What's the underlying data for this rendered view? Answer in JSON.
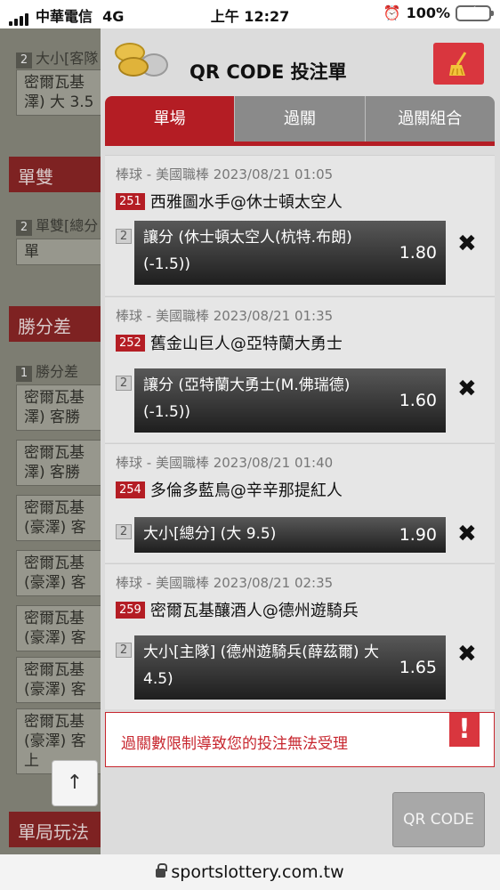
{
  "status_bar": {
    "carrier": "中華電信",
    "network": "4G",
    "time": "上午 12:27",
    "battery": "100%"
  },
  "background_page": {
    "section1": {
      "sub_num": "2",
      "sub_label": "大小[客隊",
      "box": [
        "密爾瓦基",
        "澤) 大 3.5"
      ]
    },
    "section2": {
      "title": "單雙",
      "sub_num": "2",
      "sub_label": "單雙[總分",
      "box": [
        "單"
      ]
    },
    "section3": {
      "title": "勝分差",
      "sub_num": "1",
      "sub_label": "勝分差",
      "boxes": [
        [
          "密爾瓦基",
          "澤) 客勝"
        ],
        [
          "密爾瓦基",
          "澤) 客勝"
        ],
        [
          "密爾瓦基",
          "(豪澤) 客"
        ],
        [
          "密爾瓦基",
          "(豪澤) 客"
        ],
        [
          "密爾瓦基",
          "(豪澤) 客"
        ],
        [
          "密爾瓦基",
          "(豪澤) 客"
        ],
        [
          "密爾瓦基",
          "(豪澤) 客",
          "上"
        ]
      ]
    },
    "section4": {
      "title": "單局玩法"
    },
    "up_button": "↑"
  },
  "panel": {
    "title": "QR CODE 投注單",
    "tabs": [
      {
        "label": "單場"
      },
      {
        "label": "過關"
      },
      {
        "label": "過關組合"
      }
    ],
    "bets": [
      {
        "meta": "棒球 - 美國職棒 2023/08/21 01:05",
        "match_no": "251",
        "match": "西雅圖水手@休士頓太空人",
        "sel_num": "2",
        "selection": "讓分 (休士頓太空人(杭特.布朗) (-1.5))",
        "odds": "1.80"
      },
      {
        "meta": "棒球 - 美國職棒 2023/08/21 01:35",
        "match_no": "252",
        "match": "舊金山巨人@亞特蘭大勇士",
        "sel_num": "2",
        "selection": "讓分 (亞特蘭大勇士(M.佛瑞德) (-1.5))",
        "odds": "1.60"
      },
      {
        "meta": "棒球 - 美國職棒 2023/08/21 01:40",
        "match_no": "254",
        "match": "多倫多藍鳥@辛辛那提紅人",
        "sel_num": "2",
        "selection": "大小[總分] (大 9.5)",
        "odds": "1.90"
      },
      {
        "meta": "棒球 - 美國職棒 2023/08/21 02:35",
        "match_no": "259",
        "match": "密爾瓦基釀酒人@德州遊騎兵",
        "sel_num": "2",
        "selection": "大小[主隊] (德州遊騎兵(薛茲爾) 大 4.5)",
        "odds": "1.65"
      }
    ],
    "remove_glyph": "✖",
    "error": {
      "text": "過關數限制導致您的投注無法受理",
      "icon": "!"
    },
    "qr_button": "QR CODE"
  },
  "url_bar": {
    "domain": "sportslottery.com.tw"
  },
  "colors": {
    "accent": "#b41d24",
    "tab_inactive": "#8a8a8a",
    "panel_bg": "#dcdcdc",
    "battery": "#3fc24a"
  }
}
